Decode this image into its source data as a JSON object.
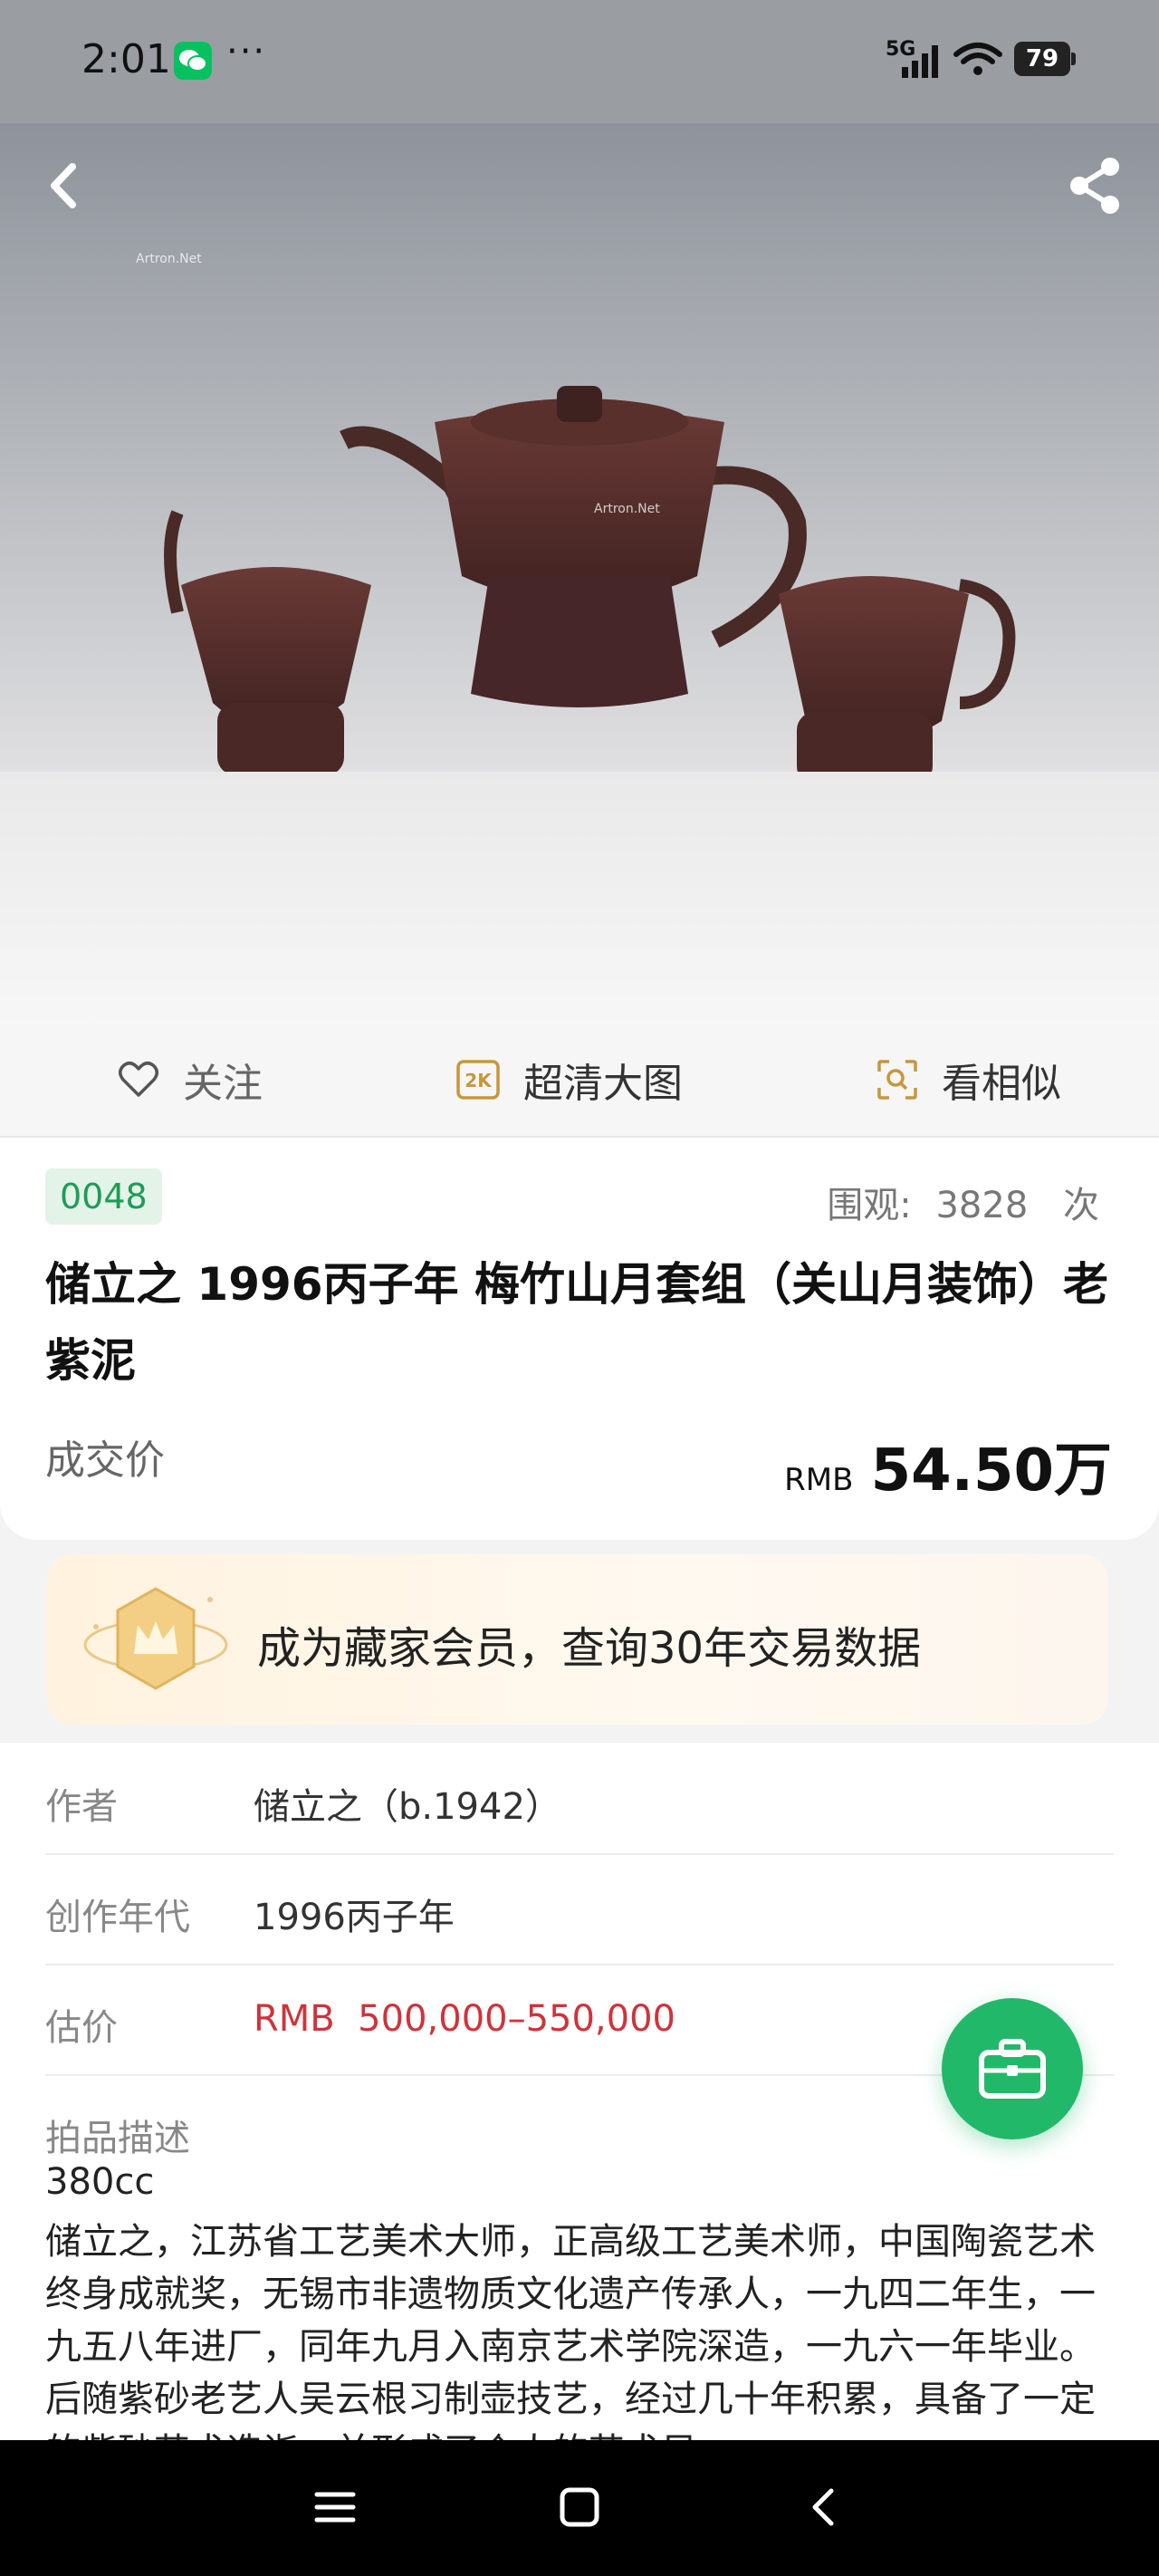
{
  "status_bar": {
    "time": "2:01",
    "dots": "···",
    "network": "5G",
    "battery": "79",
    "icons": [
      "wechat-icon",
      "signal-icon",
      "wifi-icon",
      "battery-icon"
    ]
  },
  "hero": {
    "watermark_1": "Artron.Net",
    "watermark_2": "Artron.Net",
    "icons": [
      "back-icon",
      "share-icon"
    ]
  },
  "actions": {
    "follow": "关注",
    "hd_image": "超清大图",
    "hd_badge": "2K",
    "similar": "看相似"
  },
  "lot": {
    "number": "0048",
    "views_label": "围观:",
    "views_count": "3828",
    "views_unit": "次",
    "title": "储立之 1996丙子年 梅竹山月套组（关山月装饰）老紫泥",
    "price_label": "成交价",
    "price_currency": "RMB",
    "price_value": "54.50万"
  },
  "member_banner": {
    "text": "成为藏家会员，查询30年交易数据"
  },
  "details": {
    "author_label": "作者",
    "author_value": "储立之（b.1942）",
    "year_label": "创作年代",
    "year_value": "1996丙子年",
    "estimate_label": "估价",
    "estimate_value": "RMB  500,000–550,000",
    "description_label": "拍品描述",
    "description_size": "380cc",
    "description_body": "储立之，江苏省工艺美术大师，正高级工艺美术师，中国陶瓷艺术终身成就奖，无锡市非遗物质文化遗产传承人，一九四二年生，一九五八年进厂，同年九月入南京艺术学院深造，一九六一年毕业。后随紫砂老艺人吴云根习制壶技艺，经过几十年积累，具备了一定的紫砂艺术造诣，并形成了个人的艺术风"
  },
  "colors": {
    "accent_green": "#22b869",
    "badge_green": "#1e9c57",
    "estimate_red": "#d0333a"
  }
}
